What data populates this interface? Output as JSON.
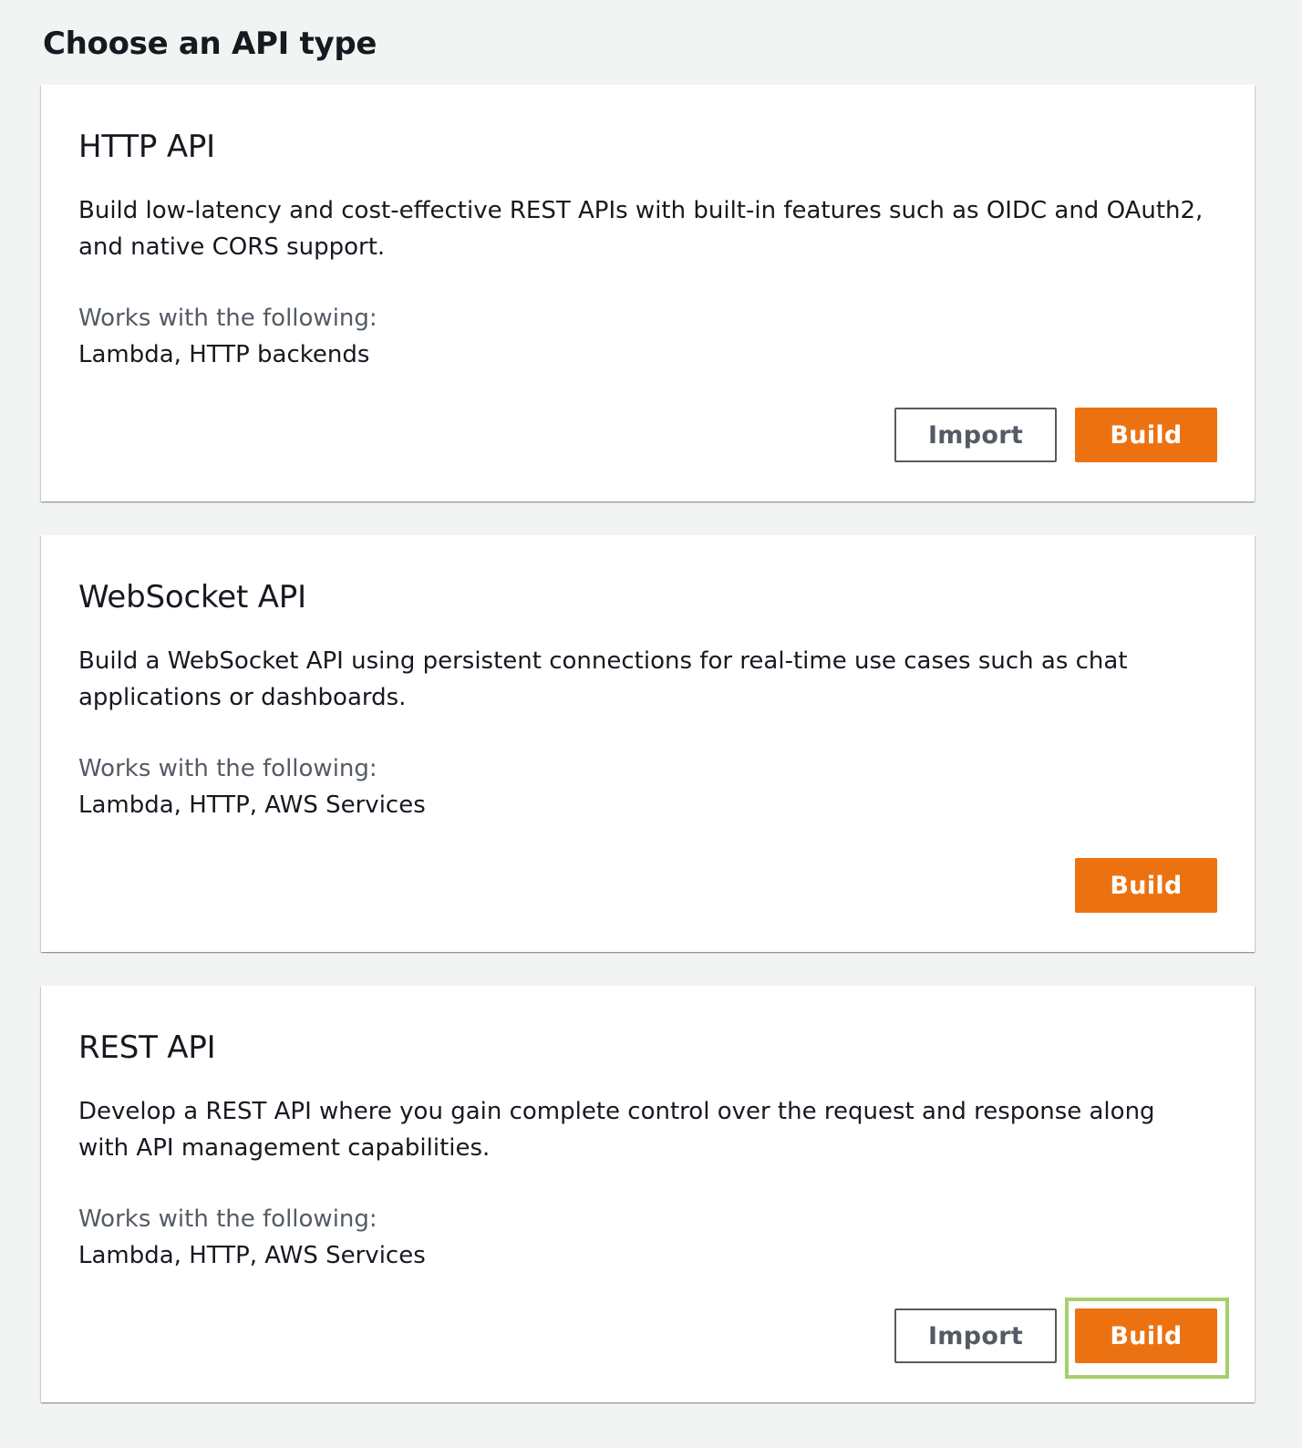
{
  "page": {
    "title": "Choose an API type"
  },
  "colors": {
    "background": "#f2f3f3",
    "card": "#ffffff",
    "primary_button": "#ec7211",
    "secondary_text": "#545b64",
    "highlight": "#a4cf6b"
  },
  "cards": [
    {
      "title": "HTTP API",
      "description": "Build low-latency and cost-effective REST APIs with built-in features such as OIDC and OAuth2, and native CORS support.",
      "works_label": "Works with the following:",
      "works_value": "Lambda, HTTP backends",
      "import_label": "Import",
      "build_label": "Build"
    },
    {
      "title": "WebSocket API",
      "description": "Build a WebSocket API using persistent connections for real-time use cases such as chat applications or dashboards.",
      "works_label": "Works with the following:",
      "works_value": "Lambda, HTTP, AWS Services",
      "build_label": "Build"
    },
    {
      "title": "REST API",
      "description": "Develop a REST API where you gain complete control over the request and response along with API management capabilities.",
      "works_label": "Works with the following:",
      "works_value": "Lambda, HTTP, AWS Services",
      "import_label": "Import",
      "build_label": "Build"
    }
  ]
}
